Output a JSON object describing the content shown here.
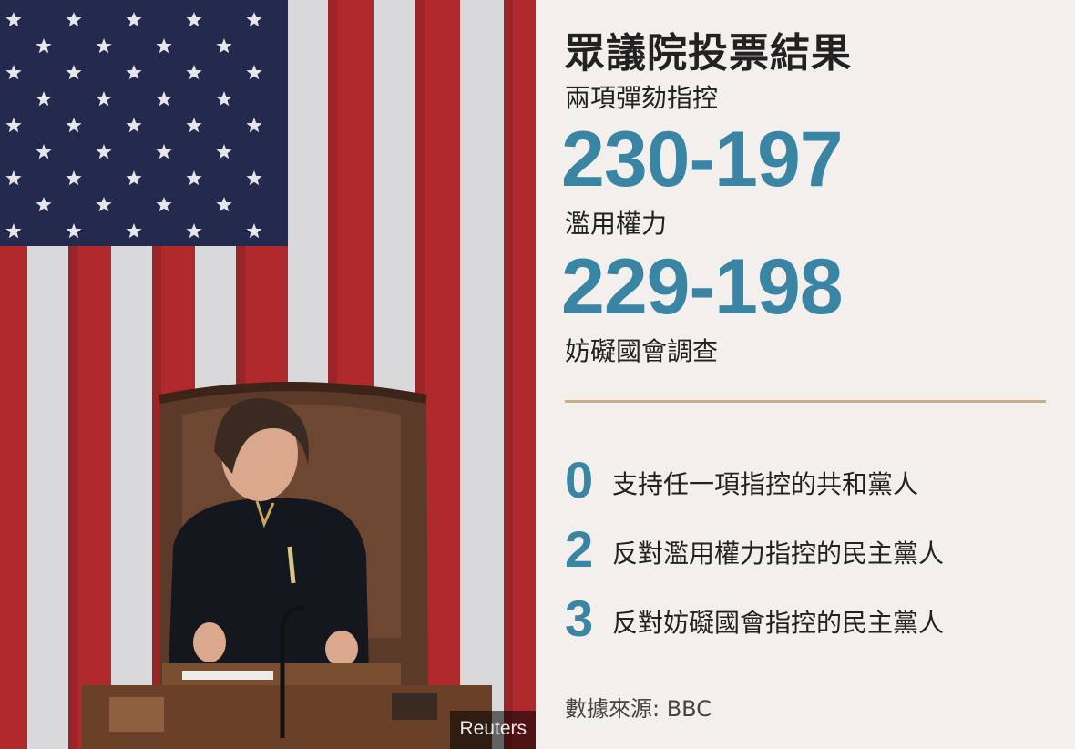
{
  "photo": {
    "credit": "Reuters"
  },
  "panel": {
    "title": "眾議院投票結果",
    "subtitle": "兩項彈劾指控",
    "vote1_label": "濫用權力",
    "vote1_value": "230-197",
    "vote2_label": "妨礙國會調查",
    "vote2_value": "229-198",
    "stats": [
      {
        "number": "0",
        "text": "支持任一項指控的共和黨人"
      },
      {
        "number": "2",
        "text": "反對濫用權力指控的民主黨人"
      },
      {
        "number": "3",
        "text": "反對妨礙國會指控的民主黨人"
      }
    ],
    "source": "數據來源: BBC"
  },
  "colors": {
    "accent": "#3a84a4",
    "divider": "#c8ae82",
    "background": "#f2efec"
  }
}
